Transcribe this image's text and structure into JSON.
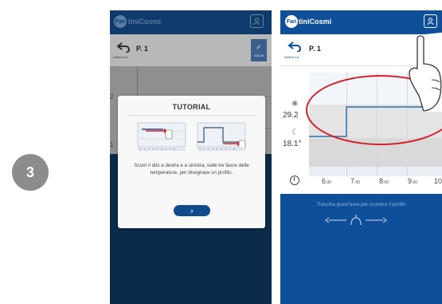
{
  "step_number": "3",
  "colors": {
    "badge": "#8c8c8c",
    "brand_blue": "#0f4f9a",
    "dim_blue": "#0b2a4a",
    "highlight_red": "#d41e26",
    "chart_line": "#5b8ab8"
  },
  "phone_left": {
    "logo_mark": "Fan",
    "logo_text": "tiniCosmi",
    "toolbar": {
      "back_label": "ANNULLA",
      "title": "P. 1",
      "save_label": "SALVA"
    },
    "side_numbers": [
      "2",
      "1"
    ],
    "tutorial": {
      "title": "TUTORIAL",
      "body": "Scorri il dito a destra e a sinistra, sulle tre fasce delle temperature, per disegnare un profilo.",
      "next_button": "›",
      "illustration_ticks_a": "0 1 2 3 4 5 6 7 8",
      "illustration_ticks_b": "0 1 2 3 4 5 6 7 8"
    }
  },
  "phone_right": {
    "logo_mark": "Fan",
    "logo_text": "tiniCosmi",
    "toolbar": {
      "back_label": "ANNULLA",
      "title": "P. 1",
      "save_label": "SALVA"
    },
    "temps": {
      "comfort": "29.2",
      "economy": "18.1°"
    },
    "icons": {
      "comfort": "sun-icon",
      "economy": "moon-icon",
      "time": "clock-icon"
    },
    "time_axis": [
      {
        "h": "6",
        "m": ".00"
      },
      {
        "h": "7",
        "m": ".00"
      },
      {
        "h": "8",
        "m": ".00"
      },
      {
        "h": "9",
        "m": ".00"
      },
      {
        "h": "10",
        "m": ""
      }
    ],
    "scroll_hint": "Trascina quest'area per scorrere il profilo"
  }
}
